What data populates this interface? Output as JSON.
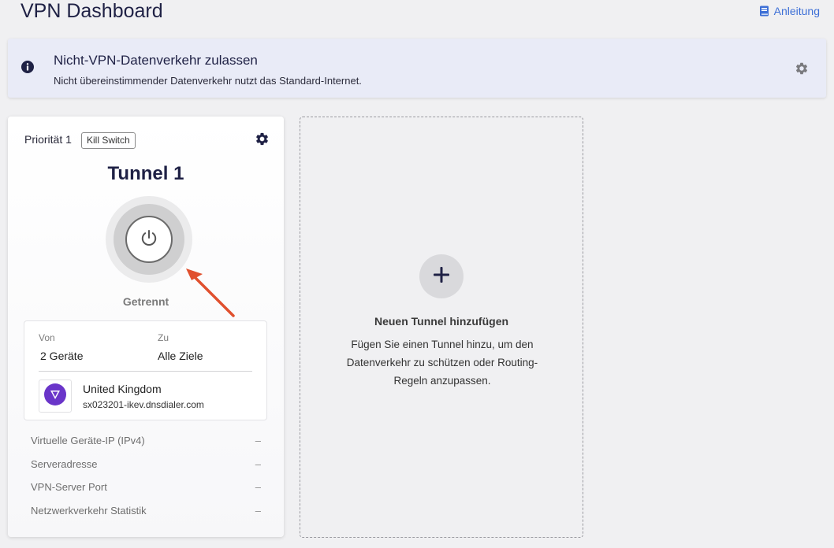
{
  "header": {
    "title": "VPN Dashboard",
    "guide_link": "Anleitung"
  },
  "banner": {
    "title": "Nicht-VPN-Datenverkehr zulassen",
    "subtitle": "Nicht übereinstimmender Datenverkehr nutzt das Standard-Internet."
  },
  "tunnel": {
    "priority": "Priorität 1",
    "kill_switch": "Kill Switch",
    "name": "Tunnel 1",
    "status": "Getrennt",
    "from_label": "Von",
    "from_value": "2 Geräte",
    "to_label": "Zu",
    "to_value": "Alle Ziele",
    "server_country": "United Kingdom",
    "server_host": "sx023201-ikev.dnsdialer.com",
    "stats": [
      {
        "label": "Virtuelle Geräte-IP (IPv4)",
        "value": "–"
      },
      {
        "label": "Serveradresse",
        "value": "–"
      },
      {
        "label": "VPN-Server Port",
        "value": "–"
      },
      {
        "label": "Netzwerkverkehr Statistik",
        "value": "–"
      }
    ]
  },
  "add_tunnel": {
    "title": "Neuen Tunnel hinzufügen",
    "description": "Fügen Sie einen Tunnel hinzu, um den Datenverkehr zu schützen oder Routing-Regeln anzupassen."
  },
  "colors": {
    "accent": "#3d6fd6",
    "annotation_arrow": "#e0502e",
    "server_logo": "#6a35c9"
  },
  "icons": [
    "book-icon",
    "info-icon",
    "gear-icon",
    "power-icon",
    "plus-icon",
    "shield-logo-icon"
  ]
}
